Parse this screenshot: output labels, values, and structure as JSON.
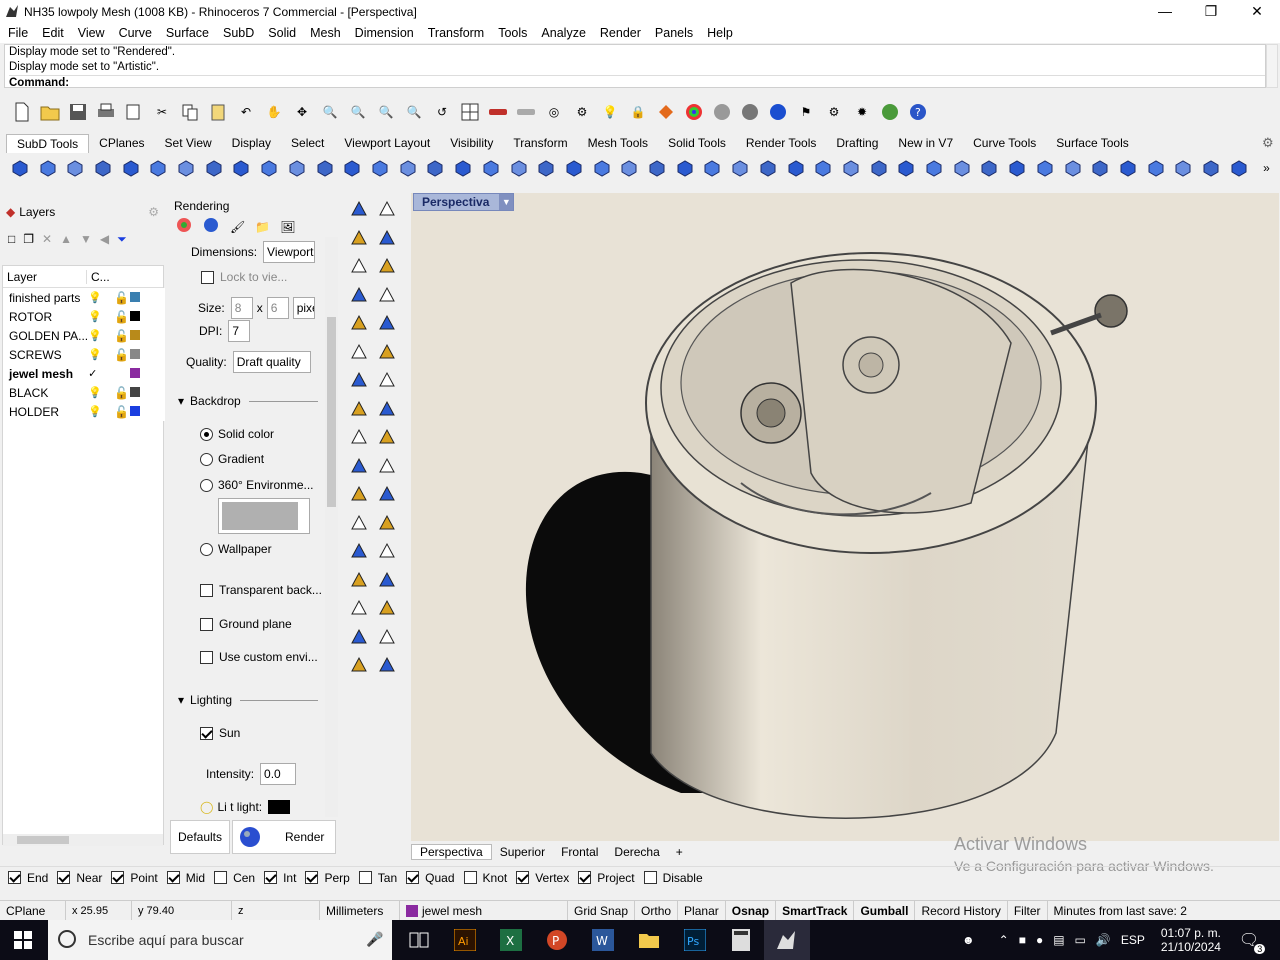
{
  "window": {
    "title": "NH35 lowpoly Mesh (1008 KB) - Rhinoceros 7 Commercial - [Perspectiva]"
  },
  "menu": [
    "File",
    "Edit",
    "View",
    "Curve",
    "Surface",
    "SubD",
    "Solid",
    "Mesh",
    "Dimension",
    "Transform",
    "Tools",
    "Analyze",
    "Render",
    "Panels",
    "Help"
  ],
  "command": {
    "history": [
      "Display mode set to \"Rendered\".",
      "Display mode set to \"Artistic\"."
    ],
    "prompt": "Command:"
  },
  "tabs": [
    "SubD Tools",
    "CPlanes",
    "Set View",
    "Display",
    "Select",
    "Viewport Layout",
    "Visibility",
    "Transform",
    "Mesh Tools",
    "Solid Tools",
    "Render Tools",
    "Drafting",
    "New in V7",
    "Curve Tools",
    "Surface Tools"
  ],
  "layers_panel": {
    "title": "Layers",
    "col_layer": "Layer",
    "col_color": "C...",
    "items": [
      {
        "name": "finished parts",
        "color": "#3a7fb0",
        "current": false
      },
      {
        "name": "ROTOR",
        "color": "#000000",
        "current": false
      },
      {
        "name": "GOLDEN PA...",
        "color": "#b88a1a",
        "current": false
      },
      {
        "name": "SCREWS",
        "color": "#888888",
        "current": false
      },
      {
        "name": "jewel mesh",
        "color": "#8a2aa0",
        "current": true
      },
      {
        "name": "BLACK",
        "color": "#444444",
        "current": false
      },
      {
        "name": "HOLDER",
        "color": "#1a3ee0",
        "current": false
      }
    ]
  },
  "rendering_panel": {
    "title": "Rendering",
    "dimensions_label": "Dimensions:",
    "dimensions_value": "Viewport",
    "lock": "Lock to vie...",
    "size_label": "Size:",
    "size_w": "8",
    "size_x": "x",
    "size_h": "6",
    "size_unit": "pixe",
    "dpi_label": "DPI:",
    "dpi_value": "7",
    "quality_label": "Quality:",
    "quality_value": "Draft quality",
    "backdrop": "Backdrop",
    "solid": "Solid color",
    "gradient": "Gradient",
    "env360": "360° Environme...",
    "wallpaper": "Wallpaper",
    "transparent": "Transparent back...",
    "ground": "Ground plane",
    "custom_env": "Use custom envi...",
    "lighting": "Lighting",
    "sun": "Sun",
    "intensity_label": "Intensity:",
    "intensity_value": "0.0",
    "lightlight": "Li t light:",
    "defaults_btn": "Defaults",
    "render_btn": "Render"
  },
  "viewport": {
    "title": "Perspectiva",
    "tabs": [
      "Perspectiva",
      "Superior",
      "Frontal",
      "Derecha"
    ]
  },
  "watermark": {
    "line1": "Activar Windows",
    "line2": "Ve a Configuración para activar Windows."
  },
  "osnap": [
    {
      "label": "End",
      "on": true
    },
    {
      "label": "Near",
      "on": true
    },
    {
      "label": "Point",
      "on": true
    },
    {
      "label": "Mid",
      "on": true
    },
    {
      "label": "Cen",
      "on": false
    },
    {
      "label": "Int",
      "on": true
    },
    {
      "label": "Perp",
      "on": true
    },
    {
      "label": "Tan",
      "on": false
    },
    {
      "label": "Quad",
      "on": true
    },
    {
      "label": "Knot",
      "on": false
    },
    {
      "label": "Vertex",
      "on": true
    },
    {
      "label": "Project",
      "on": true
    },
    {
      "label": "Disable",
      "on": false
    }
  ],
  "status": {
    "cplane": "CPlane",
    "x": "x 25.95",
    "y": "y 79.40",
    "z": "z",
    "units": "Millimeters",
    "layer": "jewel mesh",
    "layer_color": "#8a2aa0",
    "grid_snap": "Grid Snap",
    "ortho": "Ortho",
    "planar": "Planar",
    "osnap": "Osnap",
    "smarttrack": "SmartTrack",
    "gumball": "Gumball",
    "record": "Record History",
    "filter": "Filter",
    "minutes": "Minutes from last save: 2"
  },
  "taskbar": {
    "search": "Escribe aquí para buscar",
    "lang": "ESP",
    "time": "01:07 p. m.",
    "date": "21/10/2024",
    "notif": "3"
  }
}
